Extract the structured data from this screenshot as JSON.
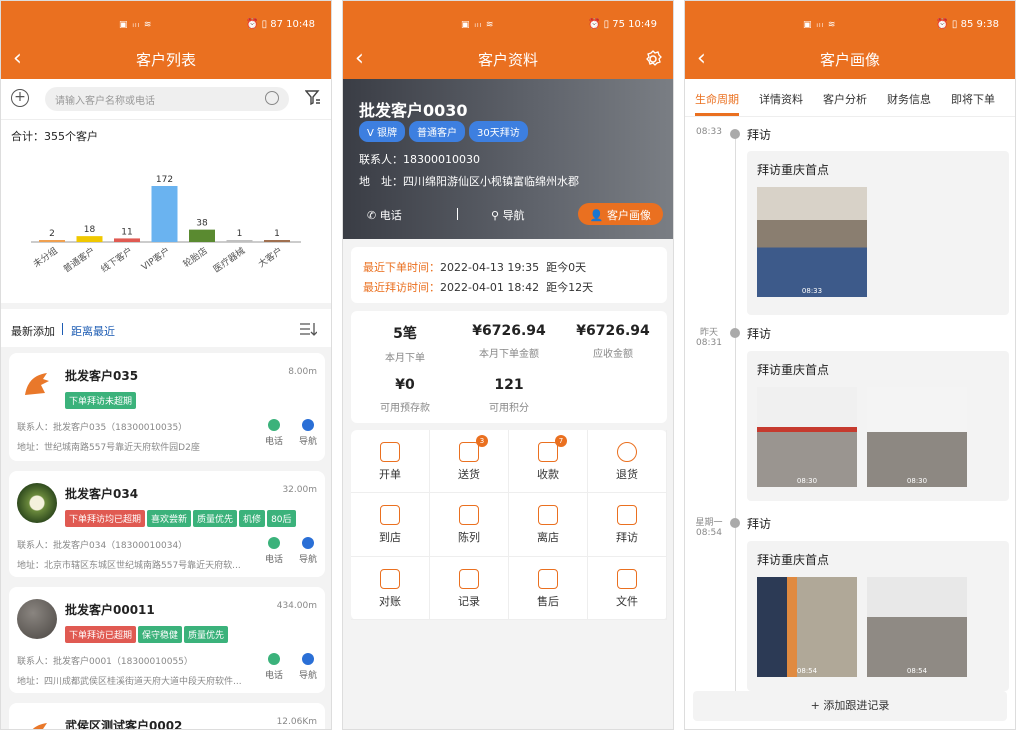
{
  "status": {
    "p1_time": "10:48",
    "p2_time": "10:49",
    "p3_time": "9:38",
    "p1_batt": "87",
    "p2_batt": "75",
    "p3_batt": "85"
  },
  "list": {
    "title": "客户列表",
    "search_placeholder": "请输入客户名称或电话",
    "total": "合计：355个客户",
    "tab_recent": "最新添加",
    "tab_near": "距离最近",
    "chart_data": {
      "type": "bar",
      "categories": [
        "未分组",
        "普通客户",
        "线下客户",
        "VIP客户",
        "轮胎店",
        "医疗器械",
        "大客户"
      ],
      "values": [
        2,
        18,
        11,
        172,
        38,
        1,
        1
      ],
      "colors": [
        "#f0a050",
        "#f0c800",
        "#e05a52",
        "#6ab3f0",
        "#5a8a30",
        "#c0c0c0",
        "#a07050"
      ]
    },
    "cards": [
      {
        "name": "批发客户035",
        "dist": "8.00m",
        "tags": [
          "下单拜访未超期"
        ],
        "tag_colors": [
          "green"
        ],
        "contact": "联系人：批发客户035（18300010035）",
        "addr": "地址：世纪城南路557号靠近天府软件园D2座",
        "call": "电话",
        "nav": "导航"
      },
      {
        "name": "批发客户034",
        "dist": "32.00m",
        "tags": [
          "下单拜访均已超期",
          "喜欢尝新",
          "质量优先",
          "机修",
          "80后"
        ],
        "tag_colors": [
          "red",
          "green",
          "green",
          "green",
          "green"
        ],
        "contact": "联系人：批发客户034（18300010034）",
        "addr": "地址：北京市辖区东城区世纪城南路557号靠近天府软...",
        "call": "电话",
        "nav": "导航"
      },
      {
        "name": "批发客户00011",
        "dist": "434.00m",
        "tags": [
          "下单拜访已超期",
          "保守稳健",
          "质量优先"
        ],
        "tag_colors": [
          "red",
          "green",
          "green"
        ],
        "contact": "联系人：批发客户0001（18300010055）",
        "addr": "地址：四川成都武侯区桂溪街道天府大道中段天府软件...",
        "call": "电话",
        "nav": "导航"
      },
      {
        "name": "武侯区测试客户0002",
        "dist": "12.06Km"
      }
    ]
  },
  "detail": {
    "title": "客户资料",
    "name": "批发客户0030",
    "tags": [
      "V 银牌",
      "普通客户",
      "30天拜访"
    ],
    "contact": "联系人：18300010030",
    "addr": "地　址：四川绵阳游仙区小枧镇富临绵州水郡",
    "call": "电话",
    "nav": "导航",
    "portrait": "客户画像",
    "last_order_label": "最近下单时间：",
    "last_order": "2022-04-13 19:35",
    "last_order_ago": "距今0天",
    "last_visit_label": "最近拜访时间：",
    "last_visit": "2022-04-01 18:42",
    "last_visit_ago": "距今12天",
    "stats": [
      {
        "value": "5笔",
        "label": "本月下单"
      },
      {
        "value": "¥6726.94",
        "label": "本月下单金额"
      },
      {
        "value": "¥6726.94",
        "label": "应收金额"
      },
      {
        "value": "¥0",
        "label": "可用预存款"
      },
      {
        "value": "121",
        "label": "可用积分"
      }
    ],
    "actions": [
      {
        "label": "开单"
      },
      {
        "label": "送货",
        "badge": "3"
      },
      {
        "label": "收款",
        "badge": "7"
      },
      {
        "label": "退货"
      },
      {
        "label": "到店"
      },
      {
        "label": "陈列"
      },
      {
        "label": "离店"
      },
      {
        "label": "拜访"
      },
      {
        "label": "对账"
      },
      {
        "label": "记录"
      },
      {
        "label": "售后"
      },
      {
        "label": "文件"
      }
    ]
  },
  "portrait": {
    "title": "客户画像",
    "tabs": [
      "生命周期",
      "详情资料",
      "客户分析",
      "财务信息",
      "即将下单"
    ],
    "entries": [
      {
        "time": "08:33",
        "type": "拜访",
        "card_title": "拜访重庆首点",
        "photos": [
          "08:33"
        ]
      },
      {
        "time": "昨天\n08:31",
        "type": "拜访",
        "card_title": "拜访重庆首点",
        "photos": [
          "08:30",
          "08:30"
        ]
      },
      {
        "time": "星期一\n08:54",
        "type": "拜访",
        "card_title": "拜访重庆首点",
        "photos": [
          "08:54",
          "08:54"
        ]
      }
    ],
    "add": "+ 添加跟进记录"
  }
}
